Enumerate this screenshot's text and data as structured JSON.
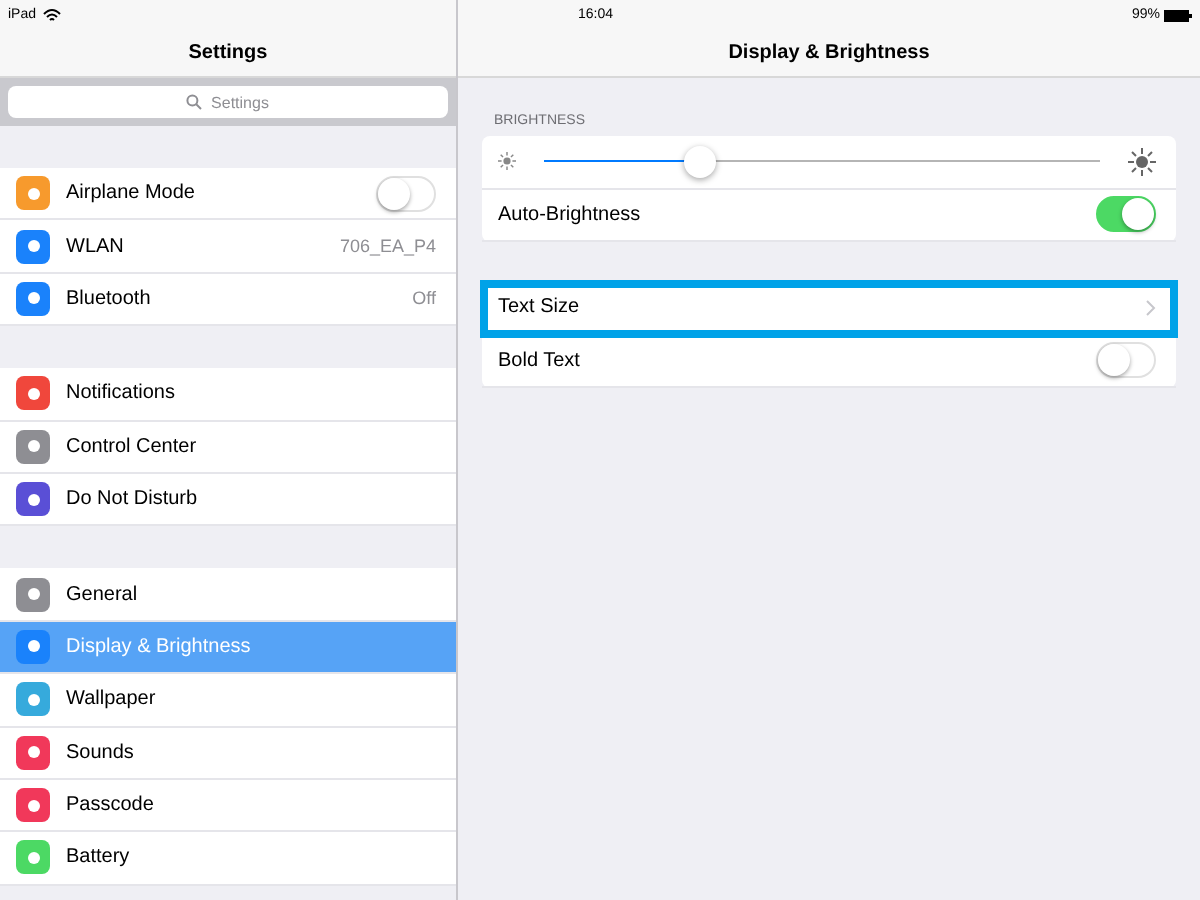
{
  "status_bar": {
    "device": "iPad",
    "time": "16:04",
    "battery": "99%"
  },
  "sidebar": {
    "title": "Settings",
    "search": {
      "placeholder": "Settings"
    },
    "groups": [
      [
        {
          "label": "Airplane Mode",
          "kind": "toggle",
          "on": false,
          "color": "#f79a2d",
          "selected": false
        },
        {
          "label": "WLAN",
          "kind": "value",
          "value": "706_EA_P4",
          "color": "#1a82fb",
          "selected": false
        },
        {
          "label": "Bluetooth",
          "kind": "value",
          "value": "Off",
          "color": "#1a82fb",
          "selected": false
        }
      ],
      [
        {
          "label": "Notifications",
          "kind": "plain",
          "color": "#f0473c",
          "selected": false
        },
        {
          "label": "Control Center",
          "kind": "plain",
          "color": "#8e8e93",
          "selected": false
        },
        {
          "label": "Do Not Disturb",
          "kind": "plain",
          "color": "#5a4fd6",
          "selected": false
        }
      ],
      [
        {
          "label": "General",
          "kind": "plain",
          "color": "#8e8e93",
          "selected": false
        },
        {
          "label": "Display & Brightness",
          "kind": "plain",
          "color": "#1a82fb",
          "selected": true
        },
        {
          "label": "Wallpaper",
          "kind": "plain",
          "color": "#36aadc",
          "selected": false
        },
        {
          "label": "Sounds",
          "kind": "plain",
          "color": "#f1385a",
          "selected": false
        },
        {
          "label": "Passcode",
          "kind": "plain",
          "color": "#f1385a",
          "selected": false
        },
        {
          "label": "Battery",
          "kind": "plain",
          "color": "#4cd964",
          "selected": false
        }
      ]
    ]
  },
  "detail": {
    "title": "Display & Brightness",
    "section_header": "BRIGHTNESS",
    "brightness": {
      "level": 0.28
    },
    "auto_brightness": {
      "label": "Auto-Brightness",
      "on": true
    },
    "rows": [
      {
        "label": "Text Size",
        "kind": "link",
        "highlighted": true
      },
      {
        "label": "Bold Text",
        "kind": "toggle",
        "on": false,
        "highlighted": false
      }
    ]
  }
}
